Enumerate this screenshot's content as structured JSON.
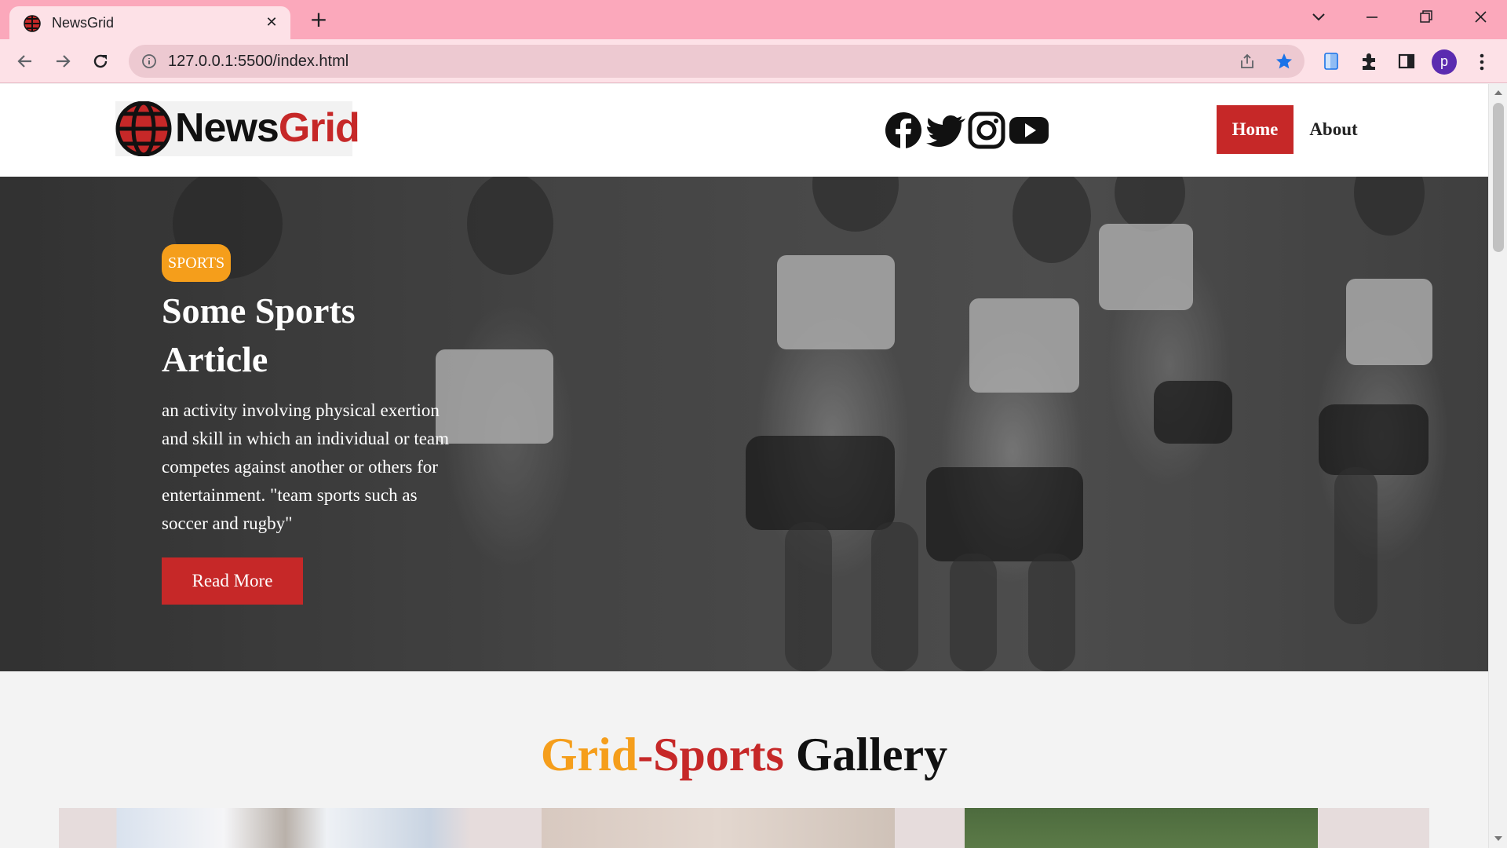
{
  "browser": {
    "tab_title": "NewsGrid",
    "url": "127.0.0.1:5500/index.html",
    "profile_initial": "p"
  },
  "site": {
    "logo_news": "News",
    "logo_grid": "Grid",
    "nav": {
      "home": "Home",
      "about": "About"
    },
    "social_icons": [
      "facebook-icon",
      "twitter-icon",
      "instagram-icon",
      "youtube-icon"
    ]
  },
  "hero": {
    "badge": "SPORTS",
    "title": "Some Sports Article",
    "text": "an activity involving physical exertion and skill in which an individual or team competes against another or others for entertainment. \"team sports such as soccer and rugby\"",
    "button": "Read More"
  },
  "gallery": {
    "title_part1": "Grid",
    "title_dash": "-",
    "title_part2": "Sports",
    "title_part3": "Gallery"
  },
  "colors": {
    "accent_red": "#c62828",
    "accent_orange": "#f59e1b",
    "chrome_pink": "#fba8bb"
  }
}
